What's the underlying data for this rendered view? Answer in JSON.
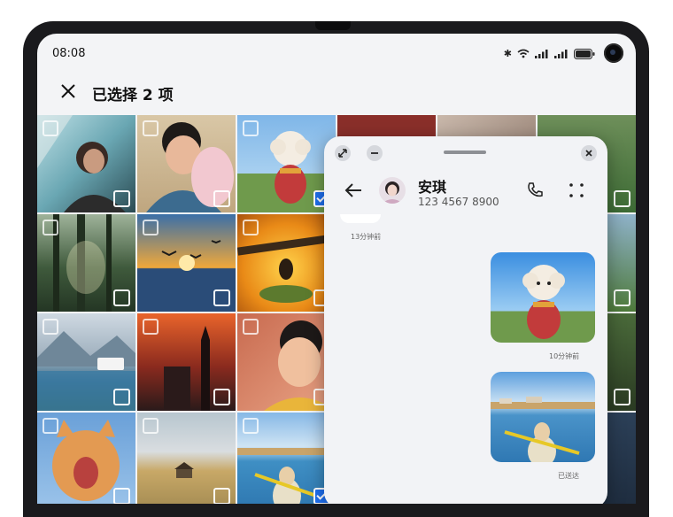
{
  "status_bar": {
    "time": "08:08"
  },
  "app_bar": {
    "title": "已选择 2 项"
  },
  "grid": {
    "tiles": [
      {
        "selected": false
      },
      {
        "selected": false
      },
      {
        "selected": true
      },
      {
        "selected": false
      },
      {
        "selected": false
      },
      {
        "selected": false
      },
      {
        "selected": false
      },
      {
        "selected": false
      },
      {
        "selected": false
      },
      {
        "selected": false
      },
      {
        "selected": false
      },
      {
        "selected": true
      }
    ]
  },
  "chat": {
    "contact_name": "安琪",
    "contact_phone": "123 4567 8900",
    "messages": [
      {
        "timestamp": "13分钟前"
      },
      {
        "timestamp": "10分钟前"
      },
      {
        "timestamp": "已送达"
      }
    ]
  },
  "colors": {
    "accent": "#1f6fef",
    "screen_bg": "#f3f4f6",
    "bezel": "#1a1a1d"
  }
}
